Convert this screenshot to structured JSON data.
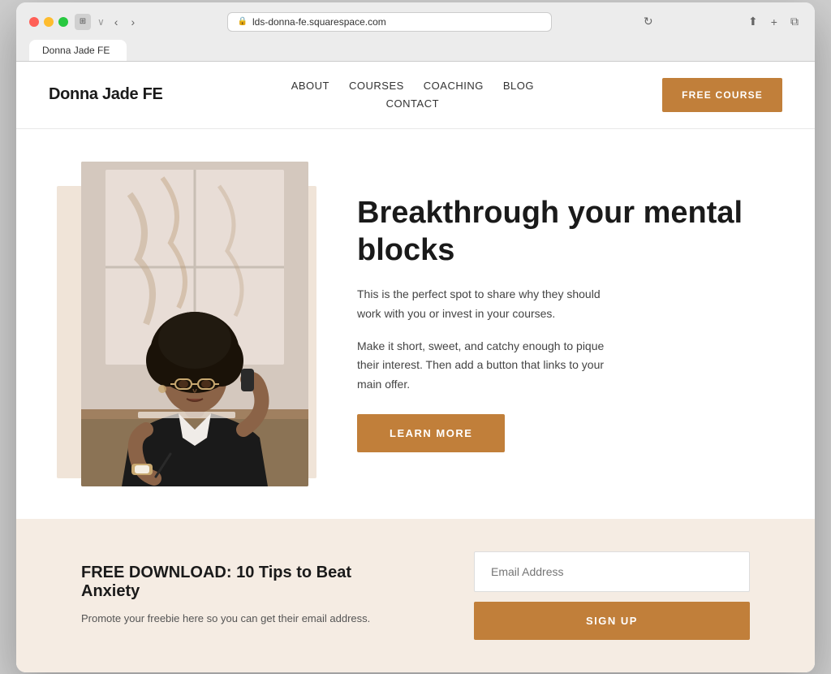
{
  "browser": {
    "url": "lds-donna-fe.squarespace.com",
    "tab_title": "Donna Jade FE"
  },
  "nav": {
    "logo": "Donna Jade FE",
    "links": [
      {
        "label": "ABOUT",
        "id": "about"
      },
      {
        "label": "COURSES",
        "id": "courses"
      },
      {
        "label": "COACHING",
        "id": "coaching"
      },
      {
        "label": "BLOG",
        "id": "blog"
      },
      {
        "label": "CONTACT",
        "id": "contact"
      }
    ],
    "cta_button": "FREE COURSE"
  },
  "hero": {
    "title": "Breakthrough your mental blocks",
    "paragraph1": "This is the perfect spot to share why they should work with you or invest in your courses.",
    "paragraph2": "Make it short, sweet, and catchy enough to pique their interest. Then add a button that links to your main offer.",
    "cta_button": "LEARN MORE"
  },
  "free_download": {
    "title": "FREE DOWNLOAD: 10 Tips to Beat Anxiety",
    "description": "Promote your freebie here so you can get their email address.",
    "email_placeholder": "Email Address",
    "signup_button": "SIGN UP"
  }
}
